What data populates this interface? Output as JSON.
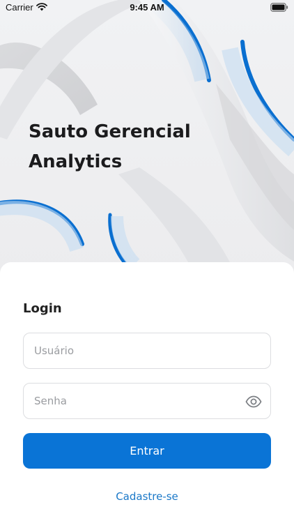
{
  "status_bar": {
    "carrier": "Carrier",
    "time": "9:45 AM"
  },
  "app": {
    "title_line1": "Sauto Gerencial",
    "title_line2": "Analytics"
  },
  "login": {
    "heading": "Login",
    "username_placeholder": "Usuário",
    "username_value": "",
    "password_placeholder": "Senha",
    "password_value": "",
    "submit_label": "Entrar",
    "signup_label": "Cadastre-se"
  },
  "colors": {
    "accent": "#0a74d6",
    "link": "#1a78c8",
    "background": "#eeeff1"
  },
  "icons": {
    "wifi": "wifi-icon",
    "battery": "battery-icon",
    "password_toggle": "eye-icon"
  }
}
